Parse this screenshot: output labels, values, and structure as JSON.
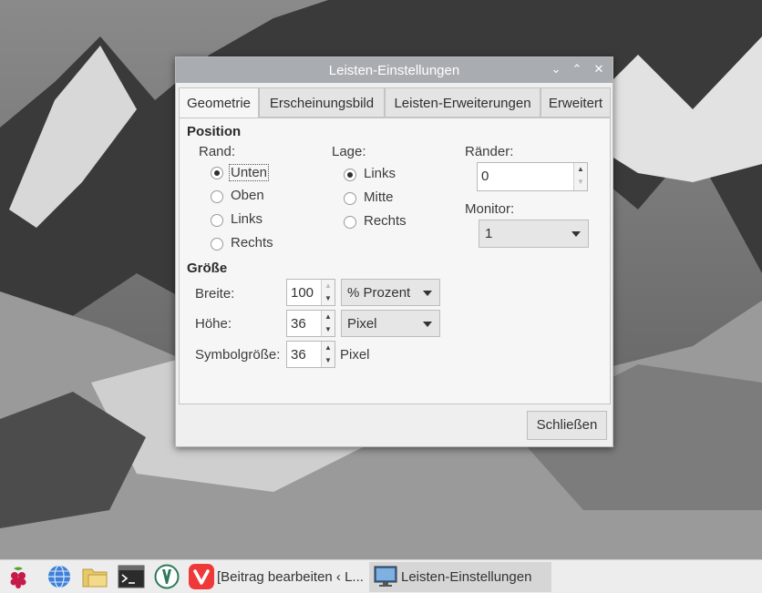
{
  "window": {
    "title": "Leisten-Einstellungen",
    "minimize_label": "⌄",
    "maximize_label": "⌃",
    "close_label": "✕"
  },
  "tabs": [
    {
      "label": "Geometrie",
      "active": true
    },
    {
      "label": "Erscheinungsbild",
      "active": false
    },
    {
      "label": "Leisten-Erweiterungen",
      "active": false
    },
    {
      "label": "Erweitert",
      "active": false
    }
  ],
  "position": {
    "heading": "Position",
    "edge": {
      "label": "Rand:",
      "options": [
        "Unten",
        "Oben",
        "Links",
        "Rechts"
      ],
      "selected": "Unten"
    },
    "alignment": {
      "label": "Lage:",
      "options": [
        "Links",
        "Mitte",
        "Rechts"
      ],
      "selected": "Links"
    },
    "margins": {
      "label": "Ränder:",
      "value": "0"
    },
    "monitor": {
      "label": "Monitor:",
      "value": "1"
    }
  },
  "size": {
    "heading": "Größe",
    "width": {
      "label": "Breite:",
      "value": "100",
      "unit": "% Prozent"
    },
    "height": {
      "label": "Höhe:",
      "value": "36",
      "unit": "Pixel"
    },
    "icon_size": {
      "label": "Symbolgröße:",
      "value": "36",
      "unit": "Pixel"
    }
  },
  "close_button": "Schließen",
  "taskbar": {
    "tasks": [
      {
        "label": "[Beitrag bearbeiten ‹ L...",
        "active": false
      },
      {
        "label": "Leisten-Einstellungen",
        "active": true
      }
    ]
  },
  "colors": {
    "titlebar": "#a9adb1",
    "dialog_bg": "#efefef",
    "taskbar_bg": "#ededed",
    "raspberry": "#c51a4a",
    "vivaldi": "#ef3939"
  }
}
